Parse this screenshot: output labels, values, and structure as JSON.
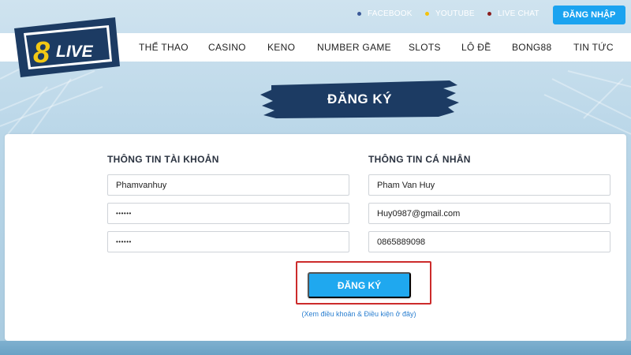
{
  "social": [
    {
      "label": "FACEBOOK",
      "icon": "facebook-icon",
      "dot": "#3b5998"
    },
    {
      "label": "YOUTUBE",
      "icon": "youtube-icon",
      "dot": "#f4c20d"
    },
    {
      "label": "LIVE CHAT",
      "icon": "livechat-icon",
      "dot": "#8b1e1e"
    }
  ],
  "header": {
    "login_label": "ĐĂNG NHẬP",
    "logo_text": "8LIVE",
    "logo_number": "8",
    "logo_word": "LIVE"
  },
  "nav": [
    {
      "label": "THỂ THAO"
    },
    {
      "label": "CASINO"
    },
    {
      "label": "KENO"
    },
    {
      "label": "NUMBER GAME"
    },
    {
      "label": "SLOTS"
    },
    {
      "label": "LÔ ĐỀ"
    },
    {
      "label": "BONG88"
    },
    {
      "label": "TIN TỨC"
    }
  ],
  "page": {
    "title": "ĐĂNG KÝ"
  },
  "form": {
    "account_title": "THÔNG TIN TÀI KHOẢN",
    "personal_title": "THÔNG TIN CÁ NHÂN",
    "username": "Phamvanhuy",
    "password": "••••••",
    "confirm_password": "••••••",
    "full_name": "Pham Van Huy",
    "email": "Huy0987@gmail.com",
    "phone": "0865889098",
    "submit_label": "ĐĂNG KÝ",
    "terms_link": "(Xem điều khoản & Điều kiện ở đây)"
  },
  "colors": {
    "accent": "#1fa8ef",
    "highlight": "#cc2b2b",
    "logo_bg": "#1c3b63",
    "logo_yellow": "#f2c814"
  }
}
